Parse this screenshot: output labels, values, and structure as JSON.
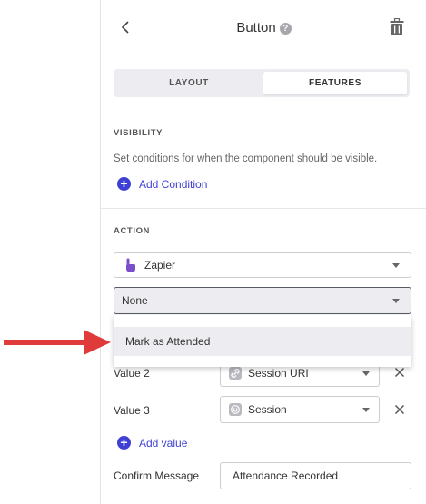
{
  "header": {
    "title": "Button",
    "help_glyph": "?"
  },
  "tabs": [
    {
      "label": "LAYOUT"
    },
    {
      "label": "FEATURES"
    }
  ],
  "visibility": {
    "title": "VISIBILITY",
    "description": "Set conditions for when the component should be visible.",
    "add_label": "Add Condition"
  },
  "action": {
    "title": "ACTION",
    "integration_value": "Zapier",
    "action_value": "None",
    "dropdown_options": [
      "Mark as Attended"
    ]
  },
  "values": [
    {
      "label": "Value 2",
      "value": "Session URI",
      "icon": "link-icon"
    },
    {
      "label": "Value 3",
      "value": "Session",
      "icon": "session-icon"
    }
  ],
  "add_value_label": "Add value",
  "confirm": {
    "label": "Confirm Message",
    "value": "Attendance Recorded"
  },
  "colors": {
    "accent": "#3e3fd4",
    "zapier_icon": "#7a4fc9",
    "arrow": "#e03b3b"
  }
}
